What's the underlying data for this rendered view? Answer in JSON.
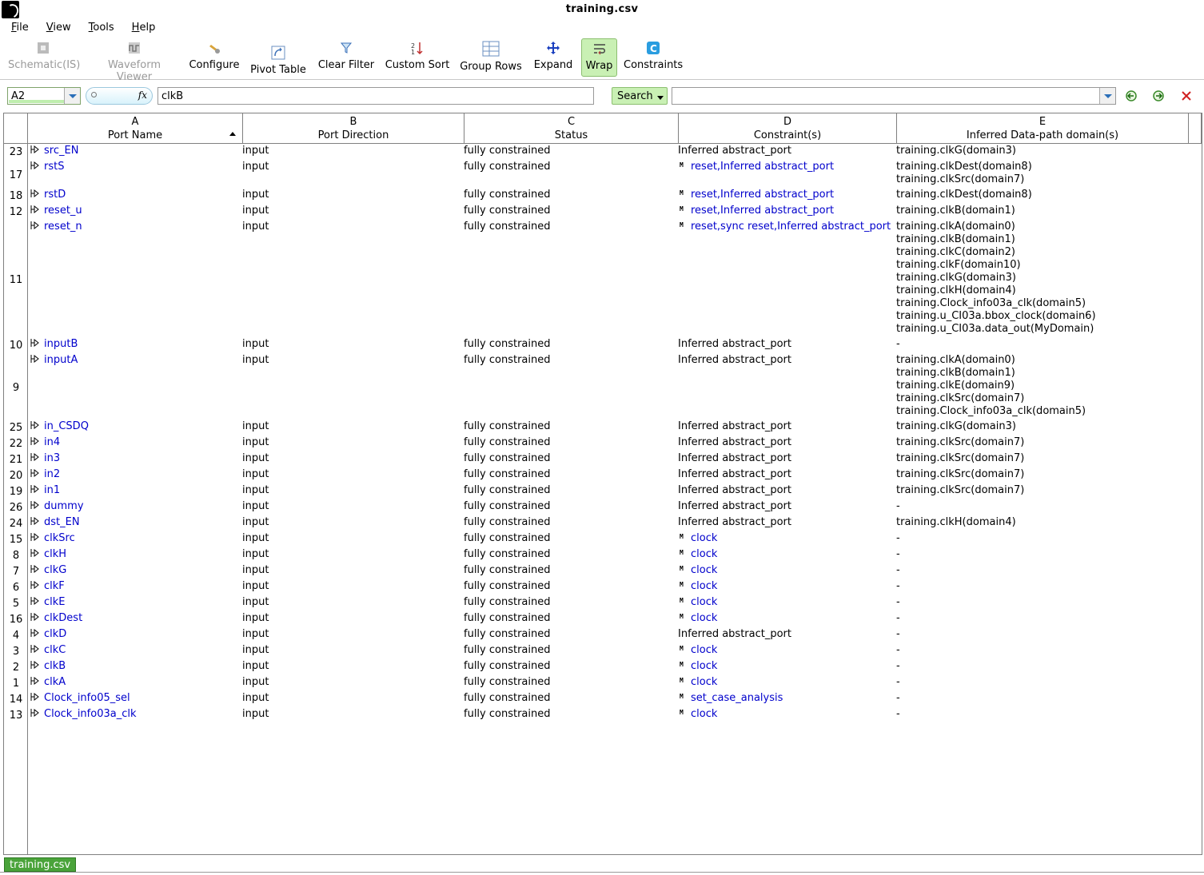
{
  "window": {
    "title": "training.csv"
  },
  "menu": [
    "File",
    "View",
    "Tools",
    "Help"
  ],
  "toolbar": {
    "schematic": "Schematic(IS)",
    "waveform": "Waveform Viewer",
    "configure": "Configure",
    "pivot": "Pivot Table",
    "clear_filter": "Clear Filter",
    "custom_sort": "Custom Sort",
    "group_rows": "Group Rows",
    "expand": "Expand",
    "wrap": "Wrap",
    "constraints": "Constraints"
  },
  "formula": {
    "cell_ref": "A2",
    "value": "clkB",
    "search_label": "Search",
    "search_value": ""
  },
  "columns": [
    {
      "letter": "A",
      "title": "Port Name"
    },
    {
      "letter": "B",
      "title": "Port Direction"
    },
    {
      "letter": "C",
      "title": "Status"
    },
    {
      "letter": "D",
      "title": "Constraint(s)"
    },
    {
      "letter": "E",
      "title": "Inferred Data-path domain(s)"
    }
  ],
  "rows": [
    {
      "num": "23",
      "port": "src_EN",
      "dir": "input",
      "status": "fully constrained",
      "cons": "Inferred abstract_port",
      "link": false,
      "dom": [
        "training.clkG(domain3)"
      ]
    },
    {
      "num": "17",
      "port": "rstS",
      "dir": "input",
      "status": "fully constrained",
      "cons": "reset,Inferred abstract_port",
      "link": true,
      "dom": [
        "training.clkDest(domain8)",
        "training.clkSrc(domain7)"
      ]
    },
    {
      "num": "18",
      "port": "rstD",
      "dir": "input",
      "status": "fully constrained",
      "cons": "reset,Inferred abstract_port",
      "link": true,
      "dom": [
        "training.clkDest(domain8)"
      ]
    },
    {
      "num": "12",
      "port": "reset_u",
      "dir": "input",
      "status": "fully constrained",
      "cons": "reset,Inferred abstract_port",
      "link": true,
      "dom": [
        "training.clkB(domain1)"
      ]
    },
    {
      "num": "11",
      "port": "reset_n",
      "dir": "input",
      "status": "fully constrained",
      "cons": "reset,sync reset,Inferred abstract_port",
      "link": true,
      "dom": [
        "training.clkA(domain0)",
        "training.clkB(domain1)",
        "training.clkC(domain2)",
        "training.clkF(domain10)",
        "training.clkG(domain3)",
        "training.clkH(domain4)",
        "training.Clock_info03a_clk(domain5)",
        "training.u_CI03a.bbox_clock(domain6)",
        "training.u_CI03a.data_out(MyDomain)"
      ]
    },
    {
      "num": "10",
      "port": "inputB",
      "dir": "input",
      "status": "fully constrained",
      "cons": "Inferred abstract_port",
      "link": false,
      "dom": [
        "-"
      ]
    },
    {
      "num": "9",
      "port": "inputA",
      "dir": "input",
      "status": "fully constrained",
      "cons": "Inferred abstract_port",
      "link": false,
      "dom": [
        "training.clkA(domain0)",
        "training.clkB(domain1)",
        "training.clkE(domain9)",
        "training.clkSrc(domain7)",
        "training.Clock_info03a_clk(domain5)"
      ]
    },
    {
      "num": "25",
      "port": "in_CSDQ",
      "dir": "input",
      "status": "fully constrained",
      "cons": "Inferred abstract_port",
      "link": false,
      "dom": [
        "training.clkG(domain3)"
      ]
    },
    {
      "num": "22",
      "port": "in4",
      "dir": "input",
      "status": "fully constrained",
      "cons": "Inferred abstract_port",
      "link": false,
      "dom": [
        "training.clkSrc(domain7)"
      ]
    },
    {
      "num": "21",
      "port": "in3",
      "dir": "input",
      "status": "fully constrained",
      "cons": "Inferred abstract_port",
      "link": false,
      "dom": [
        "training.clkSrc(domain7)"
      ]
    },
    {
      "num": "20",
      "port": "in2",
      "dir": "input",
      "status": "fully constrained",
      "cons": "Inferred abstract_port",
      "link": false,
      "dom": [
        "training.clkSrc(domain7)"
      ]
    },
    {
      "num": "19",
      "port": "in1",
      "dir": "input",
      "status": "fully constrained",
      "cons": "Inferred abstract_port",
      "link": false,
      "dom": [
        "training.clkSrc(domain7)"
      ]
    },
    {
      "num": "26",
      "port": "dummy",
      "dir": "input",
      "status": "fully constrained",
      "cons": "Inferred abstract_port",
      "link": false,
      "dom": [
        "-"
      ]
    },
    {
      "num": "24",
      "port": "dst_EN",
      "dir": "input",
      "status": "fully constrained",
      "cons": "Inferred abstract_port",
      "link": false,
      "dom": [
        "training.clkH(domain4)"
      ]
    },
    {
      "num": "15",
      "port": "clkSrc",
      "dir": "input",
      "status": "fully constrained",
      "cons": "clock",
      "link": true,
      "dom": [
        "-"
      ]
    },
    {
      "num": "8",
      "port": "clkH",
      "dir": "input",
      "status": "fully constrained",
      "cons": "clock",
      "link": true,
      "dom": [
        "-"
      ]
    },
    {
      "num": "7",
      "port": "clkG",
      "dir": "input",
      "status": "fully constrained",
      "cons": "clock",
      "link": true,
      "dom": [
        "-"
      ]
    },
    {
      "num": "6",
      "port": "clkF",
      "dir": "input",
      "status": "fully constrained",
      "cons": "clock",
      "link": true,
      "dom": [
        "-"
      ]
    },
    {
      "num": "5",
      "port": "clkE",
      "dir": "input",
      "status": "fully constrained",
      "cons": "clock",
      "link": true,
      "dom": [
        "-"
      ]
    },
    {
      "num": "16",
      "port": "clkDest",
      "dir": "input",
      "status": "fully constrained",
      "cons": "clock",
      "link": true,
      "dom": [
        "-"
      ]
    },
    {
      "num": "4",
      "port": "clkD",
      "dir": "input",
      "status": "fully constrained",
      "cons": "Inferred abstract_port",
      "link": false,
      "dom": [
        "-"
      ]
    },
    {
      "num": "3",
      "port": "clkC",
      "dir": "input",
      "status": "fully constrained",
      "cons": "clock",
      "link": true,
      "dom": [
        "-"
      ]
    },
    {
      "num": "2",
      "port": "clkB",
      "dir": "input",
      "status": "fully constrained",
      "cons": "clock",
      "link": true,
      "dom": [
        "-"
      ]
    },
    {
      "num": "1",
      "port": "clkA",
      "dir": "input",
      "status": "fully constrained",
      "cons": "clock",
      "link": true,
      "dom": [
        "-"
      ]
    },
    {
      "num": "14",
      "port": "Clock_info05_sel",
      "dir": "input",
      "status": "fully constrained",
      "cons": "set_case_analysis",
      "link": true,
      "dom": [
        "-"
      ]
    },
    {
      "num": "13",
      "port": "Clock_info03a_clk",
      "dir": "input",
      "status": "fully constrained",
      "cons": "clock",
      "link": true,
      "dom": [
        "-"
      ]
    }
  ],
  "sheet_tab": "training.csv",
  "colors": {
    "accent_green": "#c9f0b4",
    "link_blue": "#0000cc",
    "tab_green": "#4aa33a"
  }
}
